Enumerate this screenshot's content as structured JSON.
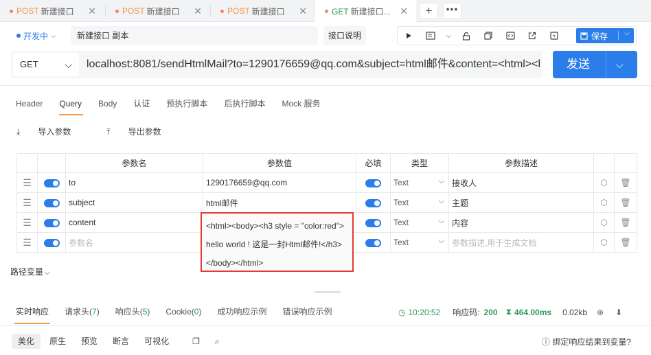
{
  "tabs": [
    {
      "method": "POST",
      "label": "新建接口"
    },
    {
      "method": "POST",
      "label": "新建接口"
    },
    {
      "method": "POST",
      "label": "新建接口"
    },
    {
      "method": "GET",
      "label": "新建接口..."
    }
  ],
  "tab_add": "+",
  "tab_more": "•••",
  "status": "开发中",
  "api_name": "新建接口 副本",
  "doc_label": "接口说明",
  "save_label": "保存",
  "method": "GET",
  "url": "localhost:8081/sendHtmlMail?to=1290176659@qq.com&subject=html邮件&content=<html><body><h3 style",
  "send_label": "发送",
  "request_tabs": [
    "Header",
    "Query",
    "Body",
    "认证",
    "预执行脚本",
    "后执行脚本",
    "Mock 服务"
  ],
  "import_label": "导入参数",
  "export_label": "导出参数",
  "table": {
    "headers": {
      "name": "参数名",
      "value": "参数值",
      "required": "必填",
      "type": "类型",
      "desc": "参数描述"
    },
    "rows": [
      {
        "name": "to",
        "value": "1290176659@qq.com",
        "type": "Text",
        "desc": "接收人"
      },
      {
        "name": "subject",
        "value": "html邮件",
        "type": "Text",
        "desc": "主题"
      },
      {
        "name": "content",
        "value": "",
        "type": "Text",
        "desc": "内容"
      }
    ],
    "new_row": {
      "name_ph": "参数名",
      "type": "Text",
      "desc_ph": "参数描述,用于生成文档"
    }
  },
  "content_value": "<html><body><h3 style = \"color:red\">hello world ! 这是一封Html邮件!</h3></body></html>",
  "path_var": "路径变量",
  "response_tabs": [
    {
      "label": "实时响应",
      "count": ""
    },
    {
      "label": "请求头",
      "count": "7"
    },
    {
      "label": "响应头",
      "count": "5"
    },
    {
      "label": "Cookie",
      "count": "0"
    },
    {
      "label": "成功响应示例",
      "count": ""
    },
    {
      "label": "错误响应示例",
      "count": ""
    }
  ],
  "response": {
    "time": "10:20:52",
    "code_label": "响应码:",
    "code": "200",
    "duration": "464.00ms",
    "size": "0.02kb"
  },
  "view_tabs": [
    "美化",
    "原生",
    "预览",
    "断言",
    "可视化"
  ],
  "bind_hint": "绑定响应结果到变量?"
}
